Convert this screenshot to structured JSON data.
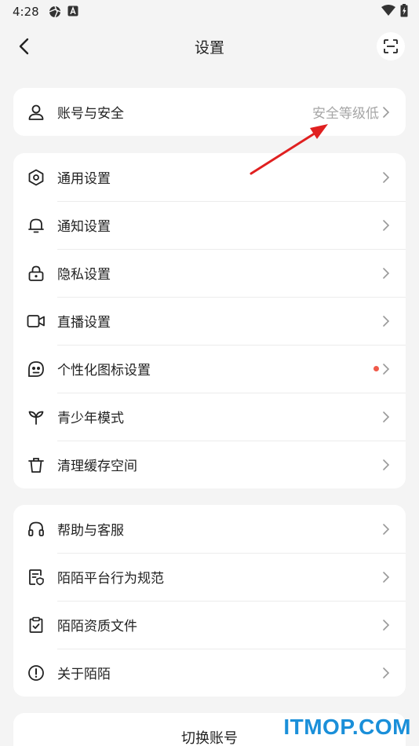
{
  "status_bar": {
    "time": "4:28"
  },
  "header": {
    "title": "设置"
  },
  "account": {
    "label": "账号与安全",
    "value": "安全等级低"
  },
  "settings": [
    {
      "label": "通用设置",
      "icon": "hexagon-settings-icon"
    },
    {
      "label": "通知设置",
      "icon": "bell-icon"
    },
    {
      "label": "隐私设置",
      "icon": "lock-icon"
    },
    {
      "label": "直播设置",
      "icon": "video-camera-icon"
    },
    {
      "label": "个性化图标设置",
      "icon": "face-icon",
      "badge": "red-dot"
    },
    {
      "label": "青少年模式",
      "icon": "sprout-icon"
    },
    {
      "label": "清理缓存空间",
      "icon": "trash-icon"
    }
  ],
  "support": [
    {
      "label": "帮助与客服",
      "icon": "headset-icon"
    },
    {
      "label": "陌陌平台行为规范",
      "icon": "document-shield-icon"
    },
    {
      "label": "陌陌资质文件",
      "icon": "clipboard-check-icon"
    },
    {
      "label": "关于陌陌",
      "icon": "info-circle-icon"
    }
  ],
  "switch_account": {
    "label": "切换账号"
  },
  "watermark": {
    "text": "ITMOP.COM"
  },
  "colors": {
    "accent_dot": "#f05a4a",
    "annotation_arrow": "#e02020",
    "watermark": "#1a8fd9"
  }
}
